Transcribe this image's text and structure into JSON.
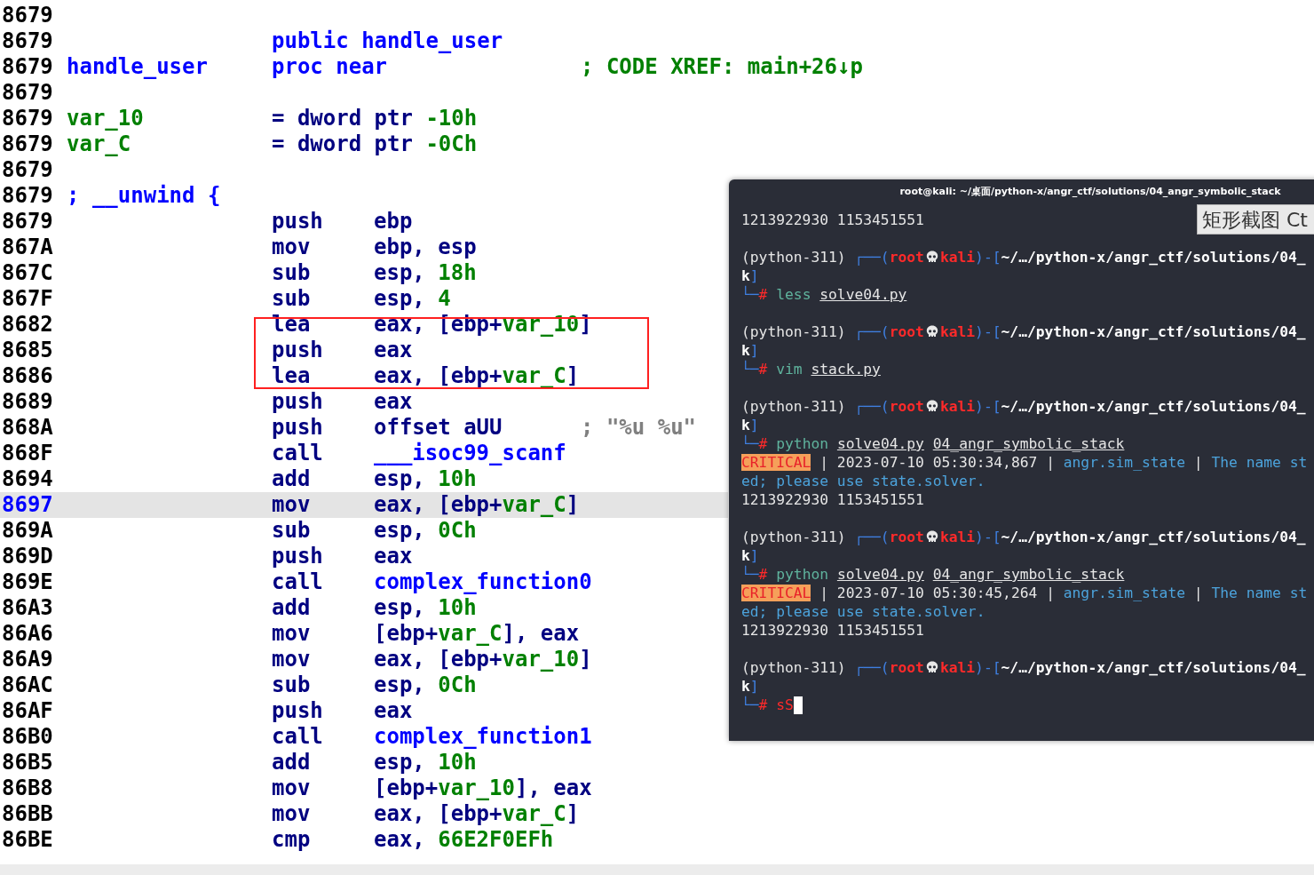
{
  "listing": {
    "rows": [
      {
        "address": "8679"
      },
      {
        "address": "8679",
        "directive": [
          {
            "text": "public handle_user",
            "kind": "name"
          }
        ]
      },
      {
        "address": "8679",
        "label": {
          "text": "handle_user",
          "kind": "name"
        },
        "directive": [
          {
            "text": "proc near",
            "kind": "name"
          }
        ],
        "comment": {
          "text": "; CODE XREF: main+26↓p",
          "kind": "xref"
        }
      },
      {
        "address": "8679"
      },
      {
        "address": "8679",
        "label": {
          "text": "var_10",
          "kind": "var"
        },
        "directive": [
          {
            "text": "= dword ptr ",
            "kind": "plain"
          },
          {
            "text": "-10h",
            "kind": "num"
          }
        ]
      },
      {
        "address": "8679",
        "label": {
          "text": "var_C",
          "kind": "var"
        },
        "directive": [
          {
            "text": "= dword ptr ",
            "kind": "plain"
          },
          {
            "text": "-0Ch",
            "kind": "num"
          }
        ]
      },
      {
        "address": "8679"
      },
      {
        "address": "8679",
        "label": {
          "text": "; __unwind {",
          "kind": "name"
        }
      },
      {
        "address": "8679",
        "mnemonic": "push",
        "operand": [
          {
            "text": "ebp",
            "kind": "plain"
          }
        ]
      },
      {
        "address": "867A",
        "mnemonic": "mov",
        "operand": [
          {
            "text": "ebp, esp",
            "kind": "plain"
          }
        ]
      },
      {
        "address": "867C",
        "mnemonic": "sub",
        "operand": [
          {
            "text": "esp, ",
            "kind": "plain"
          },
          {
            "text": "18h",
            "kind": "num"
          }
        ]
      },
      {
        "address": "867F",
        "mnemonic": "sub",
        "operand": [
          {
            "text": "esp, ",
            "kind": "plain"
          },
          {
            "text": "4",
            "kind": "num"
          }
        ]
      },
      {
        "address": "8682",
        "mnemonic": "lea",
        "operand": [
          {
            "text": "eax, [ebp+",
            "kind": "plain"
          },
          {
            "text": "var_10",
            "kind": "var"
          },
          {
            "text": "]",
            "kind": "plain"
          }
        ]
      },
      {
        "address": "8685",
        "mnemonic": "push",
        "operand": [
          {
            "text": "eax",
            "kind": "plain"
          }
        ]
      },
      {
        "address": "8686",
        "mnemonic": "lea",
        "operand": [
          {
            "text": "eax, [ebp+",
            "kind": "plain"
          },
          {
            "text": "var_C",
            "kind": "var"
          },
          {
            "text": "]",
            "kind": "plain"
          }
        ]
      },
      {
        "address": "8689",
        "mnemonic": "push",
        "operand": [
          {
            "text": "eax",
            "kind": "plain"
          }
        ]
      },
      {
        "address": "868A",
        "mnemonic": "push",
        "operand": [
          {
            "text": "offset aUU",
            "kind": "plain"
          }
        ],
        "comment": {
          "text": "; \"%u %u\"",
          "kind": "string"
        }
      },
      {
        "address": "868F",
        "mnemonic": "call",
        "operand": [
          {
            "text": "___isoc99_scanf",
            "kind": "name"
          }
        ]
      },
      {
        "address": "8694",
        "mnemonic": "add",
        "operand": [
          {
            "text": "esp, ",
            "kind": "plain"
          },
          {
            "text": "10h",
            "kind": "num"
          }
        ]
      },
      {
        "address": "8697",
        "mnemonic": "mov",
        "operand": [
          {
            "text": "eax, [ebp+",
            "kind": "plain"
          },
          {
            "text": "var_C",
            "kind": "var"
          },
          {
            "text": "]",
            "kind": "plain"
          }
        ],
        "selected": true
      },
      {
        "address": "869A",
        "mnemonic": "sub",
        "operand": [
          {
            "text": "esp, ",
            "kind": "plain"
          },
          {
            "text": "0Ch",
            "kind": "num"
          }
        ]
      },
      {
        "address": "869D",
        "mnemonic": "push",
        "operand": [
          {
            "text": "eax",
            "kind": "plain"
          }
        ]
      },
      {
        "address": "869E",
        "mnemonic": "call",
        "operand": [
          {
            "text": "complex_function0",
            "kind": "name"
          }
        ]
      },
      {
        "address": "86A3",
        "mnemonic": "add",
        "operand": [
          {
            "text": "esp, ",
            "kind": "plain"
          },
          {
            "text": "10h",
            "kind": "num"
          }
        ]
      },
      {
        "address": "86A6",
        "mnemonic": "mov",
        "operand": [
          {
            "text": "[ebp+",
            "kind": "plain"
          },
          {
            "text": "var_C",
            "kind": "var"
          },
          {
            "text": "], eax",
            "kind": "plain"
          }
        ]
      },
      {
        "address": "86A9",
        "mnemonic": "mov",
        "operand": [
          {
            "text": "eax, [ebp+",
            "kind": "plain"
          },
          {
            "text": "var_10",
            "kind": "var"
          },
          {
            "text": "]",
            "kind": "plain"
          }
        ]
      },
      {
        "address": "86AC",
        "mnemonic": "sub",
        "operand": [
          {
            "text": "esp, ",
            "kind": "plain"
          },
          {
            "text": "0Ch",
            "kind": "num"
          }
        ]
      },
      {
        "address": "86AF",
        "mnemonic": "push",
        "operand": [
          {
            "text": "eax",
            "kind": "plain"
          }
        ]
      },
      {
        "address": "86B0",
        "mnemonic": "call",
        "operand": [
          {
            "text": "complex_function1",
            "kind": "name"
          }
        ]
      },
      {
        "address": "86B5",
        "mnemonic": "add",
        "operand": [
          {
            "text": "esp, ",
            "kind": "plain"
          },
          {
            "text": "10h",
            "kind": "num"
          }
        ]
      },
      {
        "address": "86B8",
        "mnemonic": "mov",
        "operand": [
          {
            "text": "[ebp+",
            "kind": "plain"
          },
          {
            "text": "var_10",
            "kind": "var"
          },
          {
            "text": "], eax",
            "kind": "plain"
          }
        ]
      },
      {
        "address": "86BB",
        "mnemonic": "mov",
        "operand": [
          {
            "text": "eax, [ebp+",
            "kind": "plain"
          },
          {
            "text": "var_C",
            "kind": "var"
          },
          {
            "text": "]",
            "kind": "plain"
          }
        ]
      },
      {
        "address": "86BE",
        "mnemonic": "cmp",
        "operand": [
          {
            "text": "eax, ",
            "kind": "plain"
          },
          {
            "text": "66E2F0EFh",
            "kind": "num"
          }
        ]
      }
    ]
  },
  "terminal": {
    "title": "root@kali: ~/桌面/python-x/angr_ctf/solutions/04_angr_symbolic_stack",
    "tooltip": "矩形截图 Ct",
    "lines": [
      {
        "kind": "output",
        "text": "1213922930 1153451551"
      },
      {
        "kind": "prompt",
        "env": "(python-311)",
        "frame_start": "┌──(",
        "user": "root",
        "host": "kali",
        "frame_mid": ")-[",
        "path": "~/…/python-x/angr_ctf/solutions/04_",
        "path_tail": "k",
        "frame_end": "]"
      },
      {
        "kind": "command",
        "branch": "└─",
        "sigil": "#",
        "command": "less",
        "valid": true,
        "args": [
          "solve04.py"
        ]
      },
      {
        "kind": "prompt",
        "env": "(python-311)",
        "frame_start": "┌──(",
        "user": "root",
        "host": "kali",
        "frame_mid": ")-[",
        "path": "~/…/python-x/angr_ctf/solutions/04_",
        "path_tail": "k",
        "frame_end": "]"
      },
      {
        "kind": "command",
        "branch": "└─",
        "sigil": "#",
        "command": "vim",
        "valid": true,
        "args": [
          "stack.py"
        ]
      },
      {
        "kind": "prompt",
        "env": "(python-311)",
        "frame_start": "┌──(",
        "user": "root",
        "host": "kali",
        "frame_mid": ")-[",
        "path": "~/…/python-x/angr_ctf/solutions/04_",
        "path_tail": "k",
        "frame_end": "]"
      },
      {
        "kind": "command",
        "branch": "└─",
        "sigil": "#",
        "command": "python",
        "valid": true,
        "args": [
          "solve04.py",
          "04_angr_symbolic_stack"
        ]
      },
      {
        "kind": "log",
        "level": "CRITICAL",
        "sep": "|",
        "time": "2023-07-10 05:30:34,867",
        "module": "angr.sim_state",
        "message": "The name st"
      },
      {
        "kind": "wrap",
        "text": "ed; please use state.solver."
      },
      {
        "kind": "output",
        "text": "1213922930 1153451551"
      },
      {
        "kind": "prompt",
        "env": "(python-311)",
        "frame_start": "┌──(",
        "user": "root",
        "host": "kali",
        "frame_mid": ")-[",
        "path": "~/…/python-x/angr_ctf/solutions/04_",
        "path_tail": "k",
        "frame_end": "]"
      },
      {
        "kind": "command",
        "branch": "└─",
        "sigil": "#",
        "command": "python",
        "valid": true,
        "args": [
          "solve04.py",
          "04_angr_symbolic_stack"
        ]
      },
      {
        "kind": "log",
        "level": "CRITICAL",
        "sep": "|",
        "time": "2023-07-10 05:30:45,264",
        "module": "angr.sim_state",
        "message": "The name st"
      },
      {
        "kind": "wrap",
        "text": "ed; please use state.solver."
      },
      {
        "kind": "output",
        "text": "1213922930 1153451551"
      },
      {
        "kind": "prompt",
        "env": "(python-311)",
        "frame_start": "┌──(",
        "user": "root",
        "host": "kali",
        "frame_mid": ")-[",
        "path": "~/…/python-x/angr_ctf/solutions/04_",
        "path_tail": "k",
        "frame_end": "]"
      },
      {
        "kind": "command",
        "branch": "└─",
        "sigil": "#",
        "command": "sS",
        "valid": false,
        "cursor": true
      }
    ]
  }
}
